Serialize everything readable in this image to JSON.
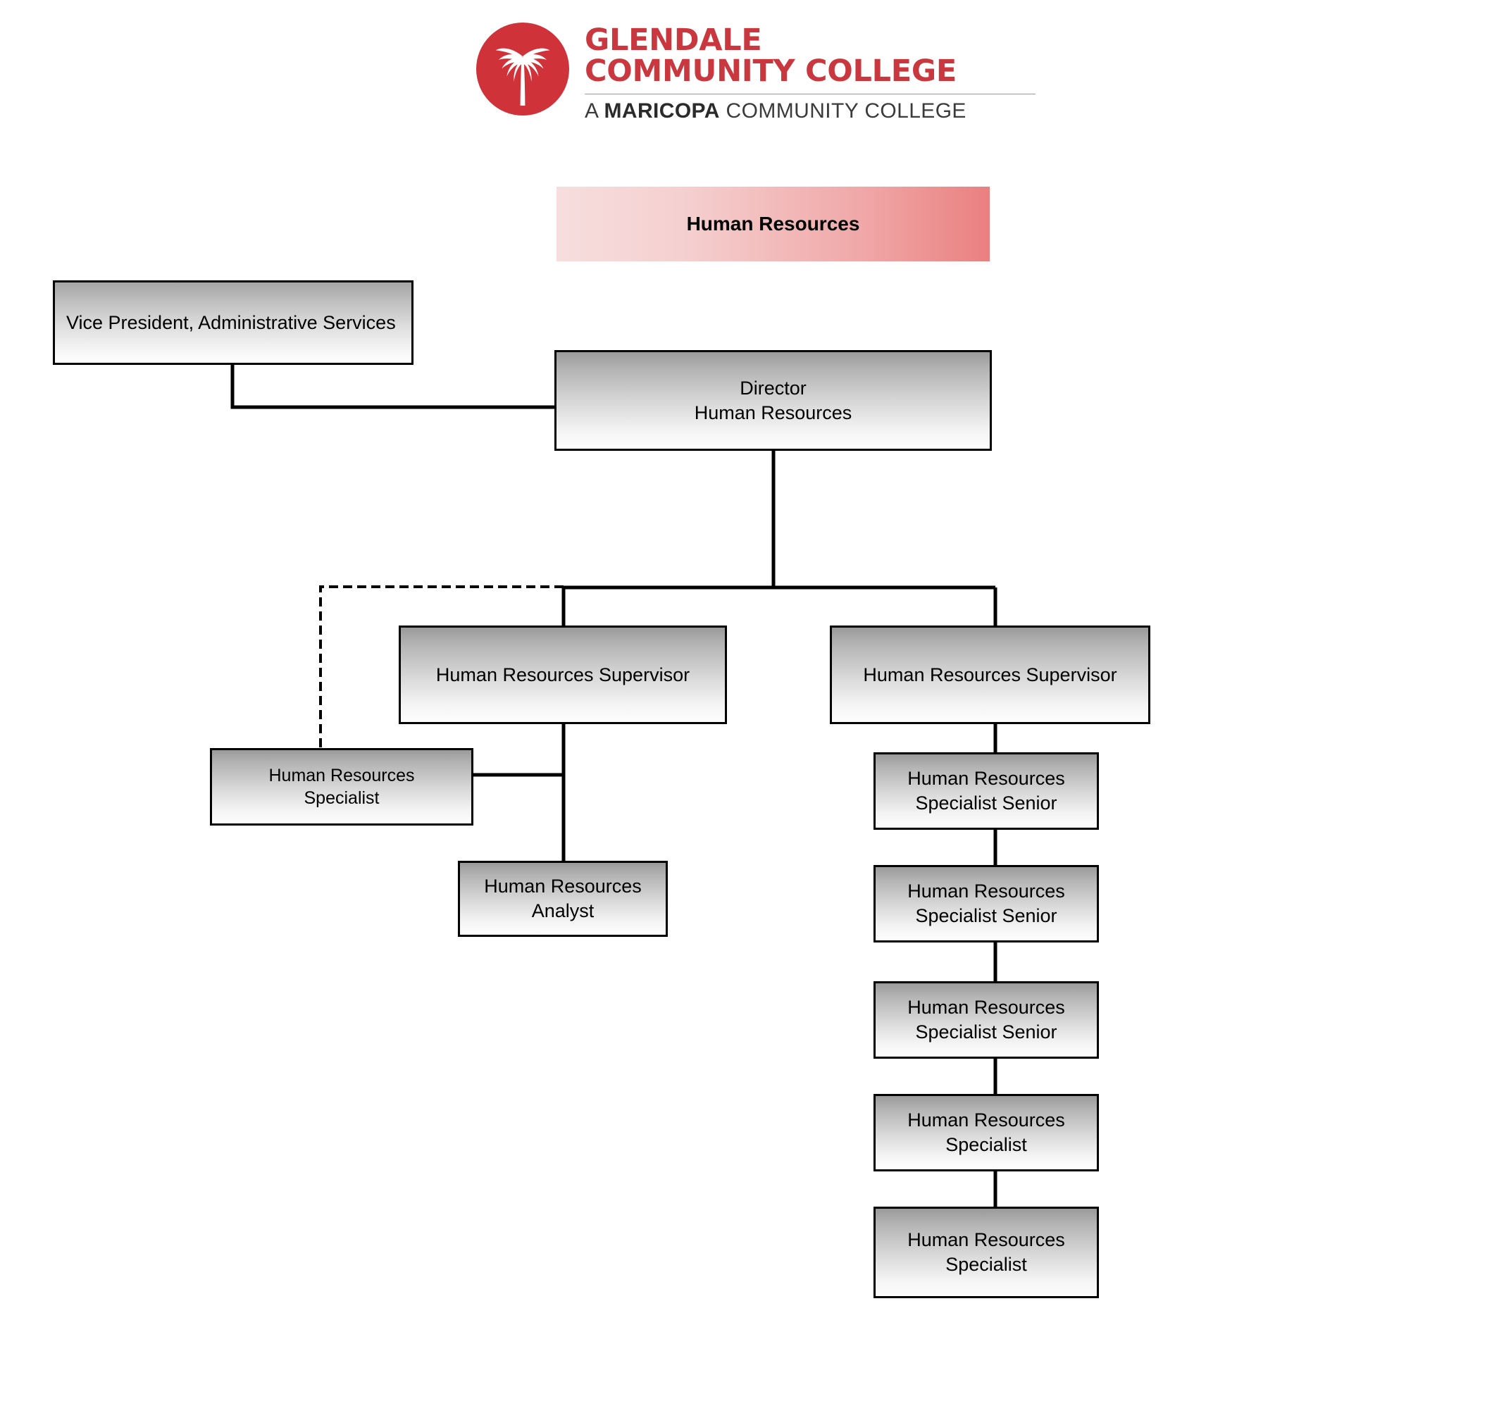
{
  "logo": {
    "icon": "palm-tree-circle-logo",
    "line1": "GLENDALE",
    "line2": "COMMUNITY COLLEGE",
    "tagline_prefix": "A ",
    "tagline_bold": "MARICOPA",
    "tagline_suffix": " COMMUNITY COLLEGE",
    "brand_color": "#c9383f",
    "tagline_color": "#3b3b3b"
  },
  "chart": {
    "title": "Human Resources",
    "banner_gradient_from": "#f7dede",
    "banner_gradient_to": "#ea8080",
    "box_border_color": "#000000",
    "box_gradient_from": "#9a9a9a",
    "box_gradient_to": "#ffffff",
    "nodes": {
      "banner": {
        "label": "Human Resources"
      },
      "vice_president": {
        "label": "Vice President, Administrative Services"
      },
      "director": {
        "line1": "Director",
        "line2": "Human Resources"
      },
      "supervisor_left": {
        "label": "Human Resources Supervisor"
      },
      "supervisor_right": {
        "label": "Human Resources Supervisor"
      },
      "specialist_left": {
        "line1": "Human Resources",
        "line2": "Specialist"
      },
      "analyst": {
        "line1": "Human Resources",
        "line2": "Analyst"
      },
      "right_col": [
        {
          "line1": "Human Resources",
          "line2": "Specialist Senior"
        },
        {
          "line1": "Human Resources",
          "line2": "Specialist Senior"
        },
        {
          "line1": "Human Resources",
          "line2": "Specialist Senior"
        },
        {
          "line1": "Human Resources",
          "line2": "Specialist"
        },
        {
          "line1": "Human Resources",
          "line2": "Specialist"
        }
      ]
    }
  }
}
